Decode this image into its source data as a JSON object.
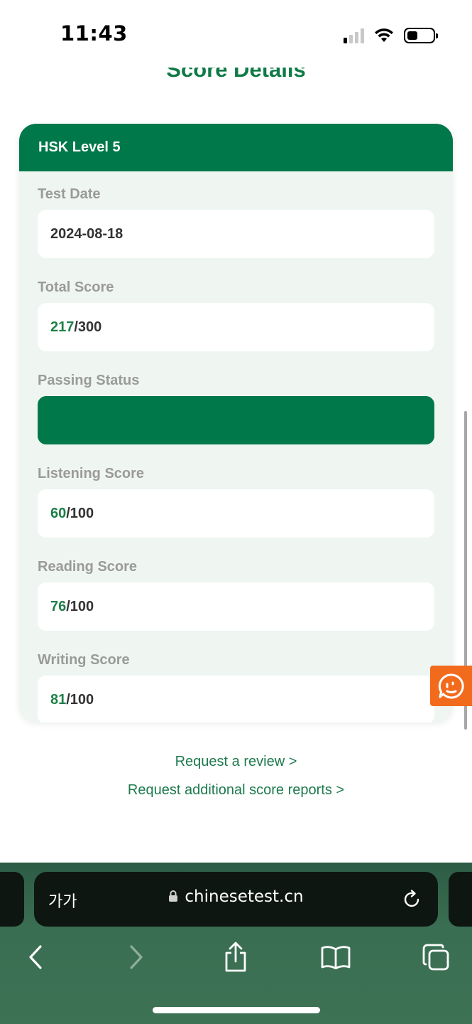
{
  "status_bar": {
    "time": "11:43"
  },
  "page": {
    "title": "Score Details"
  },
  "card": {
    "header": "HSK Level 5",
    "fields": {
      "test_date": {
        "label": "Test Date",
        "value": "2024-08-18"
      },
      "total_score": {
        "label": "Total Score",
        "score": "217",
        "max": "/300"
      },
      "passing_status": {
        "label": "Passing Status",
        "value": ""
      },
      "listening": {
        "label": "Listening Score",
        "score": "60",
        "max": "/100"
      },
      "reading": {
        "label": "Reading Score",
        "score": "76",
        "max": "/100"
      },
      "writing": {
        "label": "Writing Score",
        "score": "81",
        "max": "/100"
      }
    }
  },
  "links": {
    "review": "Request a review >",
    "reports": "Request additional score reports >"
  },
  "browser": {
    "aa_label": "가가",
    "url": "chinesetest.cn"
  },
  "colors": {
    "brand_green": "#00784a",
    "score_green": "#1e8048",
    "chat_orange": "#f26b1d"
  },
  "icons": [
    "signal-icon",
    "wifi-icon",
    "battery-icon",
    "chat-icon",
    "lock-icon",
    "reload-icon",
    "back-icon",
    "forward-icon",
    "share-icon",
    "bookmarks-icon",
    "tabs-icon"
  ]
}
